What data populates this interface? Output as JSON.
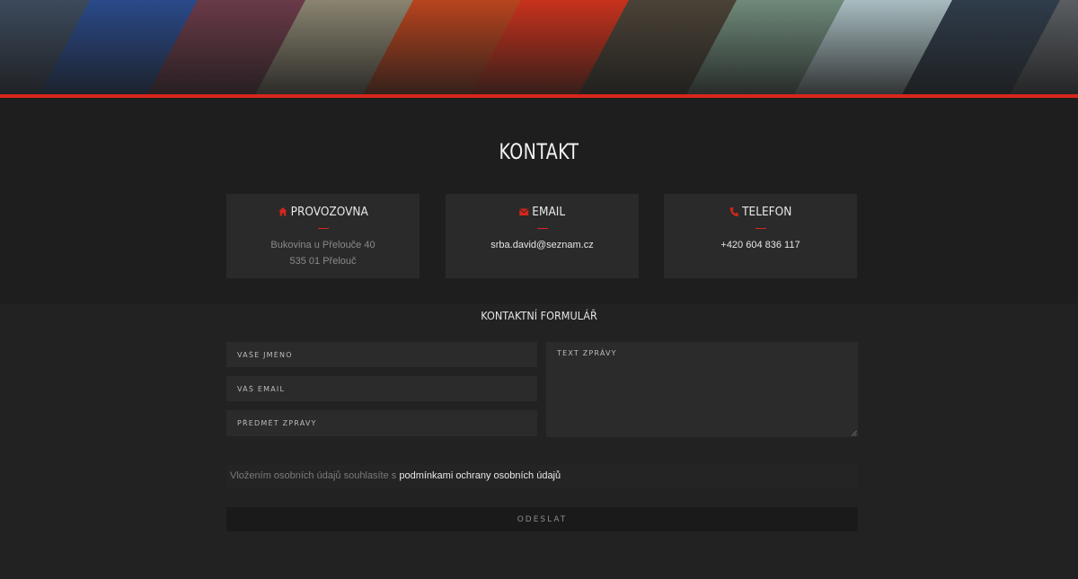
{
  "banner": {
    "alt": "Motorsport banner",
    "accent_color": "#d7261b",
    "stripes": [
      "#3c4a5c",
      "#2a4a8a",
      "#6a3a48",
      "#8a8470",
      "#b8441e",
      "#c8321c",
      "#4a4236",
      "#6f8a7a",
      "#a8bcc0",
      "#2f3c4a",
      "#5a5e62"
    ]
  },
  "page": {
    "title": "KONTAKT"
  },
  "cards": [
    {
      "icon": "home-icon",
      "title": "PROVOZOVNA",
      "lines": [
        "Bukovina u Přelouče 40",
        "535 01 Přelouč"
      ]
    },
    {
      "icon": "envelope-icon",
      "title": "EMAIL",
      "lines": [
        "srba.david@seznam.cz"
      ]
    },
    {
      "icon": "phone-icon",
      "title": "TELEFON",
      "lines": [
        "+420 604 836 117"
      ]
    }
  ],
  "form": {
    "title": "KONTAKTNÍ FORMULÁŘ",
    "name_placeholder": "VAŠE JMÉNO",
    "email_placeholder": "VÁŠ EMAIL",
    "subject_placeholder": "PŘEDMĚT ZPRÁVY",
    "message_placeholder": "TEXT ZPRÁVY",
    "consent_text": "Vložením osobních údajů souhlasíte s ",
    "consent_link": "podmínkami ochrany osobních údajů",
    "submit_label": "ODESLAT"
  }
}
